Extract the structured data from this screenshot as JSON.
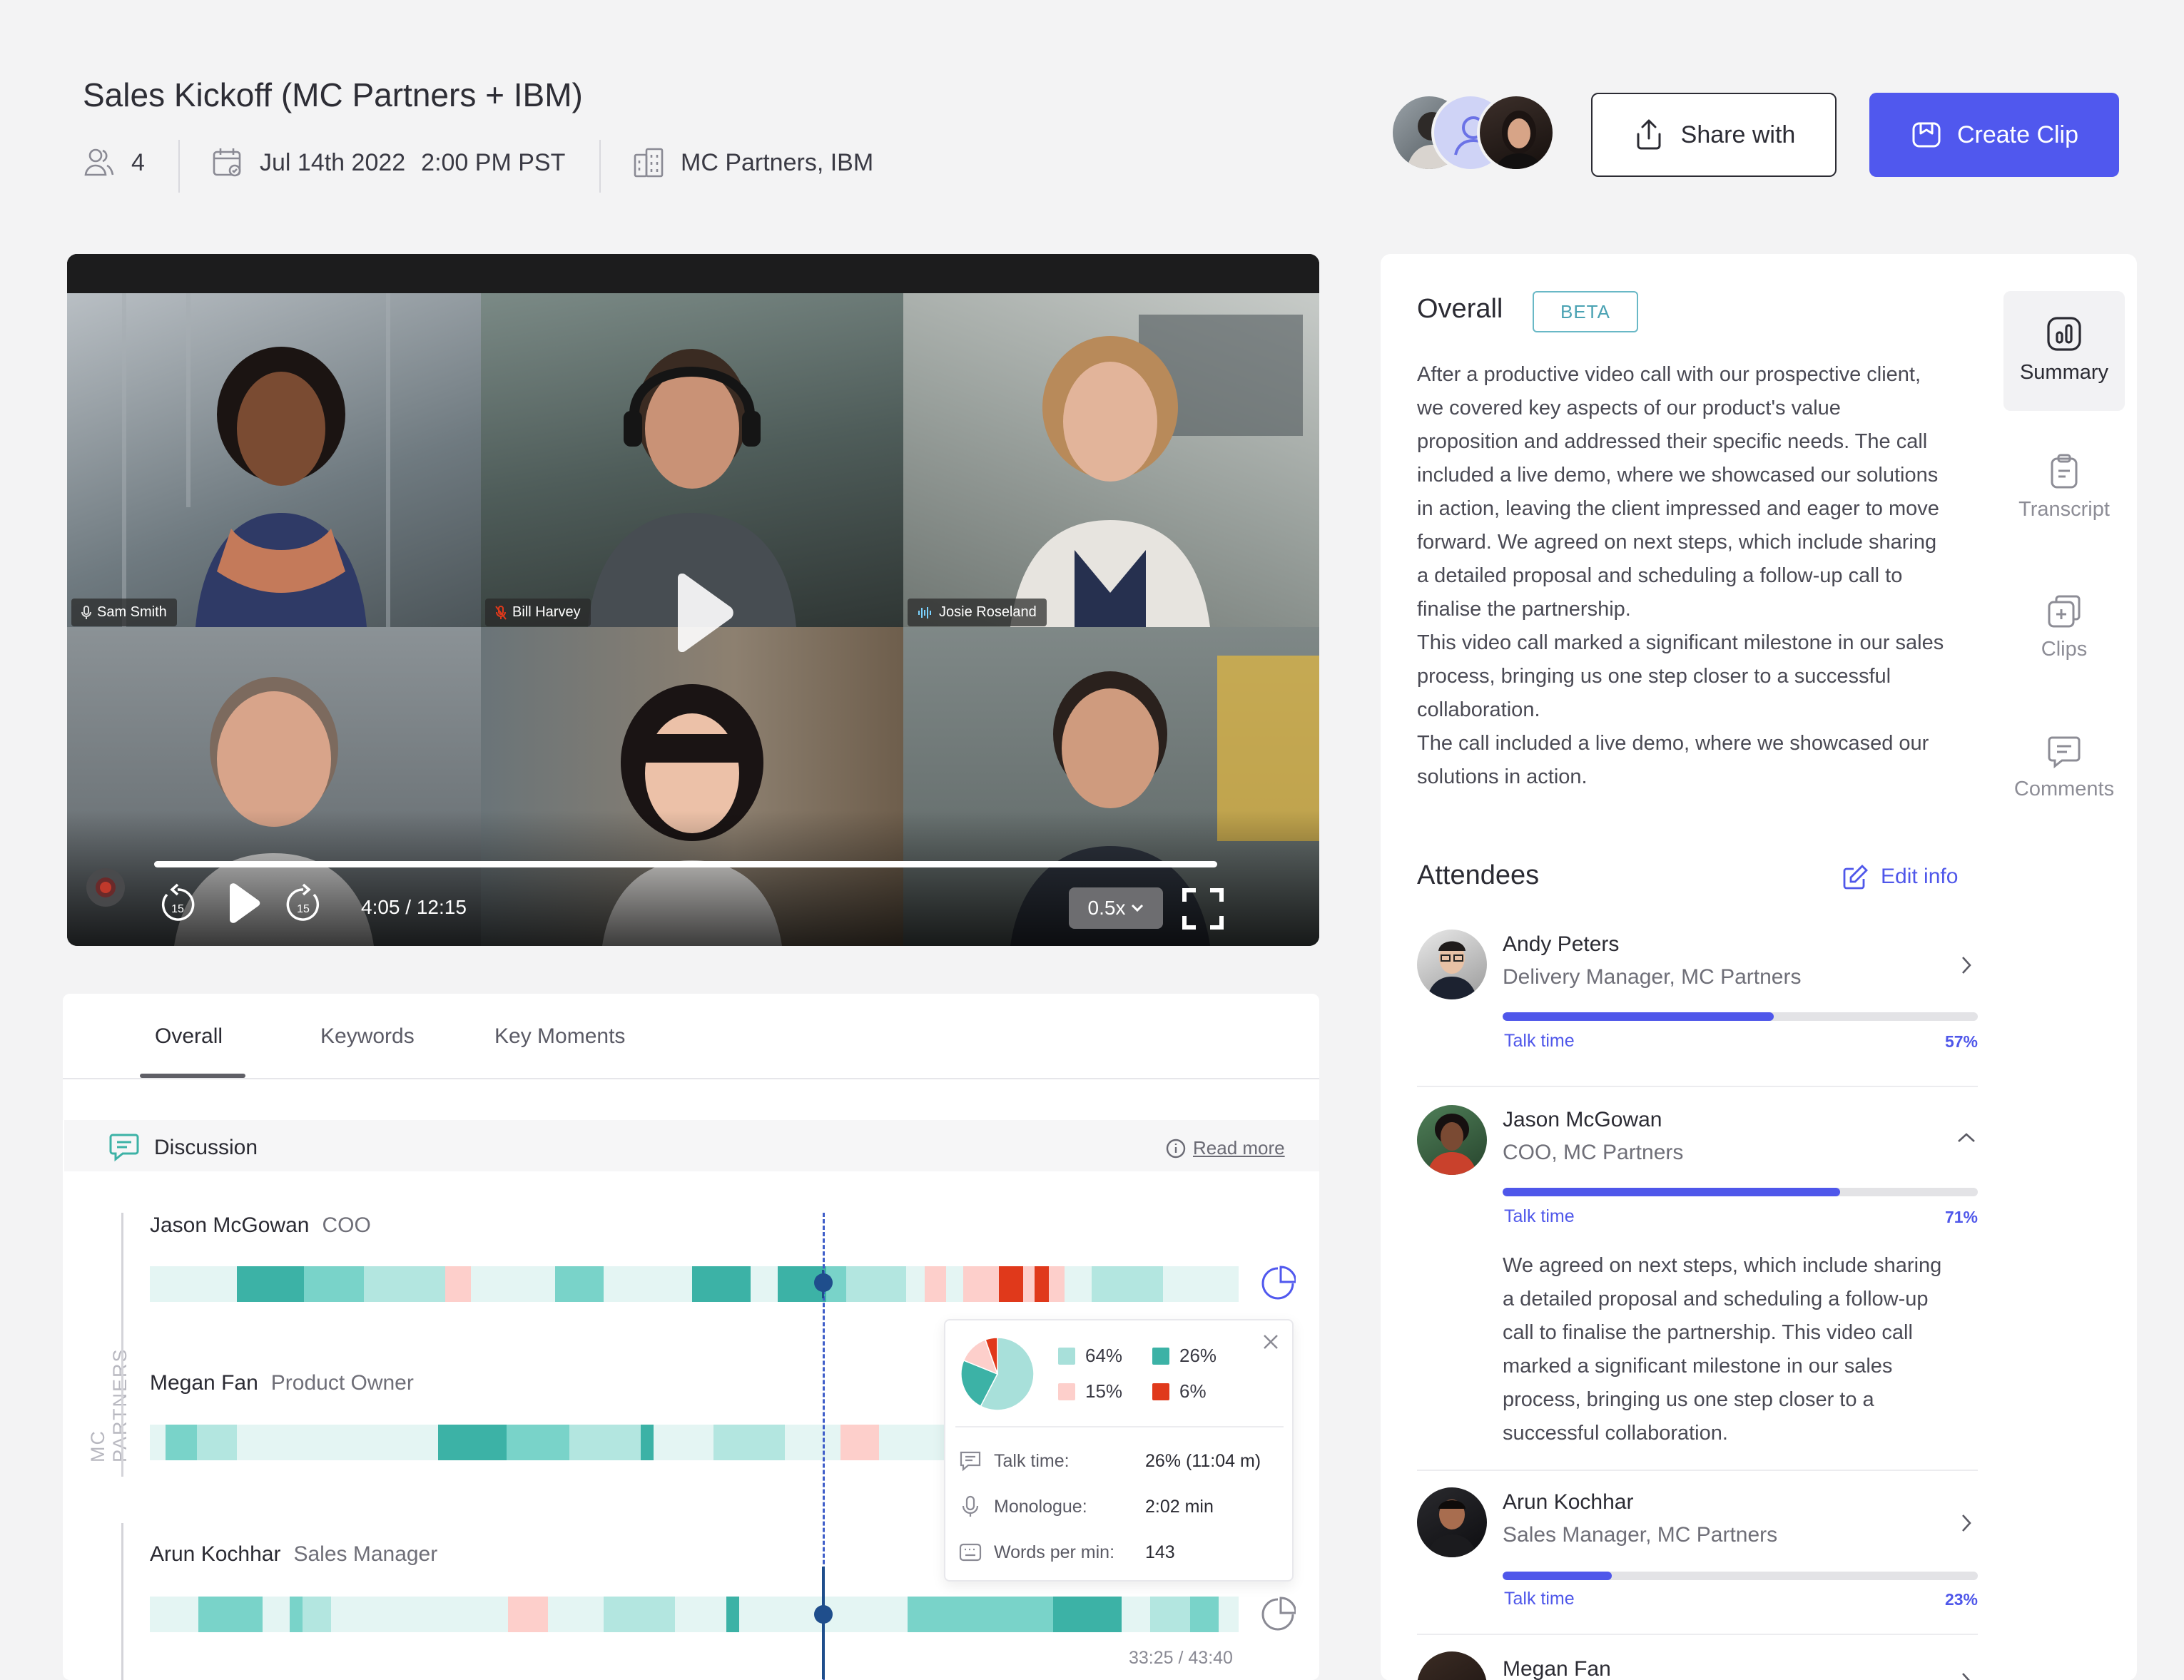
{
  "header": {
    "title": "Sales Kickoff (MC Partners + IBM)",
    "participants_count": "4",
    "date": "Jul 14th 2022",
    "time": "2:00 PM PST",
    "companies": "MC Partners,  IBM",
    "share_label": "Share with",
    "create_clip_label": "Create Clip"
  },
  "video": {
    "participants": [
      "Sam Smith",
      "Bill Harvey",
      "Josie Roseland"
    ],
    "time_display": "4:05 / 12:15",
    "speed": "0.5x",
    "skip_back": "15",
    "skip_forward": "15",
    "progress": 0.0
  },
  "tabs": {
    "items": [
      "Overall",
      "Keywords",
      "Key Moments"
    ],
    "active": "Overall"
  },
  "discussion": {
    "label": "Discussion",
    "read_more": "Read more",
    "group_label": "MC PARTNERS",
    "speakers": [
      {
        "name": "Jason McGowan",
        "role": "COO"
      },
      {
        "name": "Megan Fan",
        "role": "Product Owner"
      },
      {
        "name": "Arun Kochhar",
        "role": "Sales Manager"
      }
    ],
    "timestamp": "33:25 / 43:40",
    "popup": {
      "legend": [
        {
          "label": "64%",
          "value": 64,
          "color": "#a8e0da"
        },
        {
          "label": "26%",
          "value": 26,
          "color": "#3cb2a6"
        },
        {
          "label": "15%",
          "value": 15,
          "color": "#fdcfcb"
        },
        {
          "label": "6%",
          "value": 6,
          "color": "#e0391b"
        }
      ],
      "stats": [
        {
          "label": "Talk time:",
          "value": "26% (11:04 m)"
        },
        {
          "label": "Monologue:",
          "value": "2:02 min"
        },
        {
          "label": "Words per min:",
          "value": "143"
        }
      ]
    }
  },
  "overall": {
    "heading": "Overall",
    "badge": "BETA",
    "summary_lines": [
      "After a productive video call with our prospective client,",
      "we covered key aspects of our product's value",
      "proposition and addressed their specific needs. The call",
      "included a live demo, where we showcased our solutions",
      "in action, leaving the client impressed and eager to move",
      "forward. We agreed on next steps, which include sharing",
      "a detailed proposal and scheduling a follow-up call to",
      "finalise the partnership.",
      "This video call marked a significant milestone in our sales",
      "process, bringing us one step closer to a successful",
      "collaboration.",
      "The call included a live demo, where we showcased our",
      "solutions in action."
    ]
  },
  "side_nav": {
    "items": [
      {
        "label": "Summary",
        "icon": "bar-chart-icon",
        "active": true
      },
      {
        "label": "Transcript",
        "icon": "clipboard-icon",
        "active": false
      },
      {
        "label": "Clips",
        "icon": "clip-add-icon",
        "active": false
      },
      {
        "label": "Comments",
        "icon": "comment-icon",
        "active": false
      }
    ]
  },
  "attendees": {
    "heading": "Attendees",
    "edit_label": "Edit info",
    "talk_label": "Talk time",
    "list": [
      {
        "name": "Andy Peters",
        "role": "Delivery Manager, MC Partners",
        "talk_pct": "57%",
        "talk": 0.57
      },
      {
        "name": "Jason McGowan",
        "role": "COO, MC Partners",
        "talk_pct": "71%",
        "talk": 0.71,
        "notes": [
          "We agreed on next steps, which include sharing",
          "a detailed proposal and scheduling a follow-up",
          "call to finalise the partnership. This video call",
          "marked a significant milestone in our sales",
          "process, bringing us one step closer to a",
          "successful collaboration."
        ]
      },
      {
        "name": "Arun Kochhar",
        "role": "Sales Manager, MC Partners",
        "talk_pct": "23%",
        "talk": 0.23
      },
      {
        "name": "Megan Fan",
        "role": "",
        "talk_pct": "",
        "talk": 0
      }
    ]
  },
  "colors": {
    "accent": "#5058ee",
    "teal_dark": "#3cb2a6",
    "teal_mid": "#79d3c9",
    "teal_light": "#b3e6e0",
    "teal_bg": "#e4f5f3",
    "pink": "#fdcfcb",
    "red": "#e0391b",
    "timeline_marker": "#1f4e8c"
  }
}
